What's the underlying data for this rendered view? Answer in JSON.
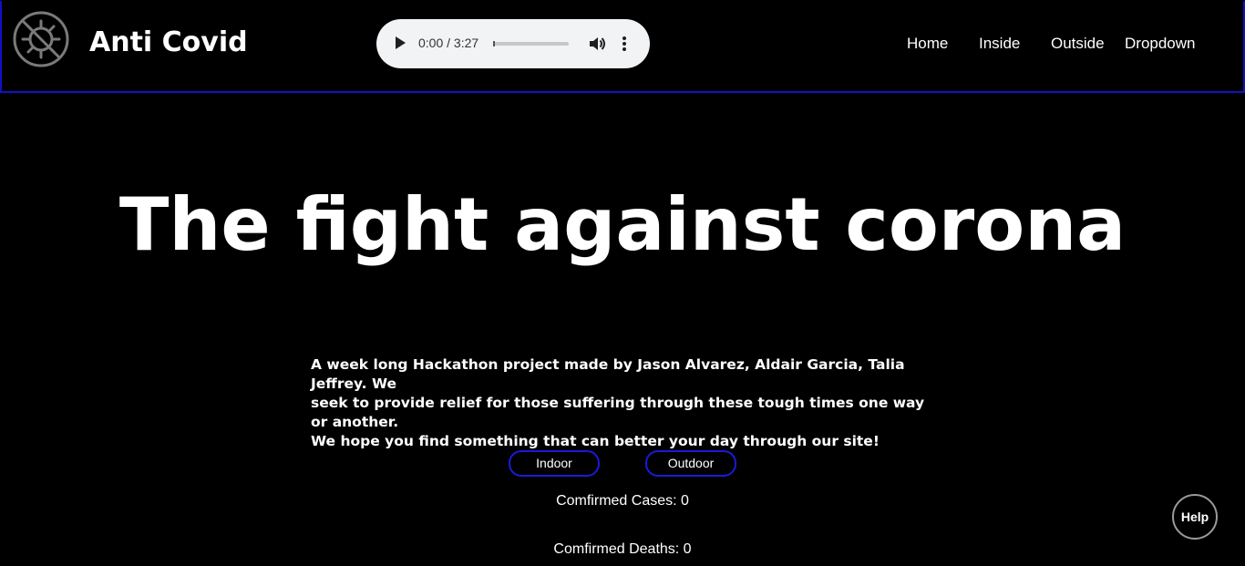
{
  "header": {
    "brand": "Anti Covid",
    "logo_icon": "no-virus-icon"
  },
  "audio_player": {
    "time": "0:00 / 3:27",
    "progress": 0
  },
  "nav": {
    "items": [
      {
        "label": "Home"
      },
      {
        "label": "Inside"
      },
      {
        "label": "Outside"
      },
      {
        "label": "Dropdown"
      }
    ]
  },
  "hero": {
    "title": "The fight against corona",
    "intro_lines": [
      "A week long Hackathon project made by Jason Alvarez, Aldair Garcia, Talia Jeffrey. We",
      "seek to provide relief for those suffering through these tough times one way or another.",
      "We hope you find something that can better your day through our site!"
    ]
  },
  "buttons": {
    "indoor": "Indoor",
    "outdoor": "Outdoor"
  },
  "stats": {
    "cases": "Comfirmed Cases: 0",
    "deaths": "Comfirmed Deaths: 0"
  },
  "help": {
    "label": "Help"
  },
  "colors": {
    "accent": "#1a1ad8",
    "background": "#000000",
    "text": "#ffffff"
  }
}
